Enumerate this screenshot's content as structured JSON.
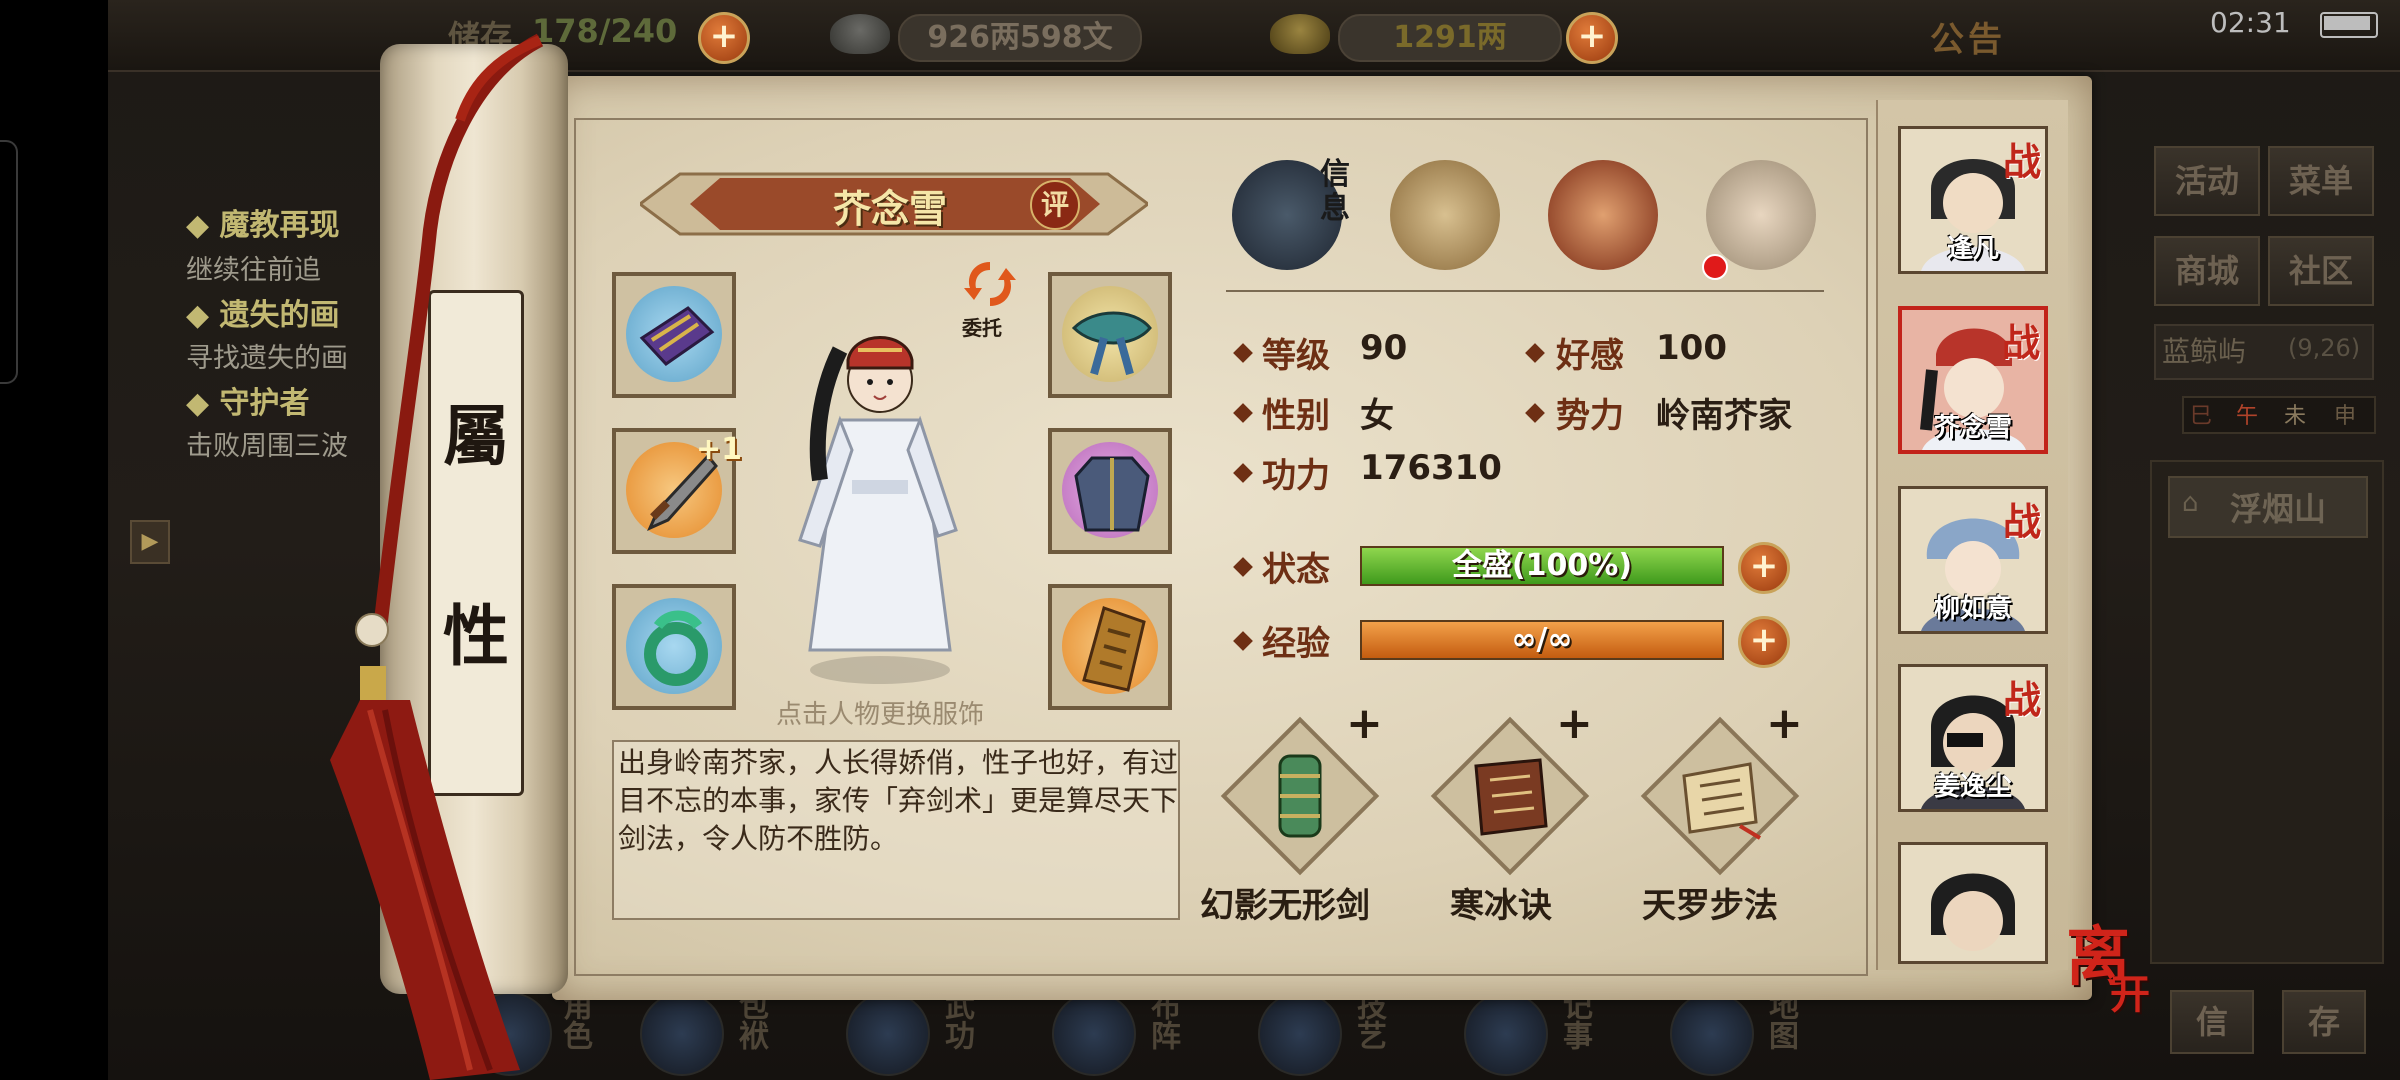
{
  "topbar": {
    "storage_label": "储存",
    "storage_value": "178/240",
    "money": "926两598文",
    "gold": "1291两",
    "announcement": "公告",
    "clock": "02:31"
  },
  "quests": [
    {
      "title": "魔教再现",
      "desc": "继续往前追"
    },
    {
      "title": "遗失的画",
      "desc": "寻找遗失的画"
    },
    {
      "title": "守护者",
      "desc": "击败周围三波"
    }
  ],
  "right_menu": {
    "activity": "活动",
    "menu": "菜单",
    "shop": "商城",
    "community": "社区",
    "location": "蓝鲸屿",
    "coords": "(9,26)",
    "time_marks": [
      "巳",
      "午",
      "未",
      "申"
    ],
    "destination": "浮烟山",
    "info_btn": "信",
    "save_btn": "存"
  },
  "scroll_tab": {
    "char1": "屬",
    "char2": "性"
  },
  "character": {
    "name": "芥念雪",
    "rate_label": "评",
    "delegate_label": "委托",
    "outfit_tip": "点击人物更换服饰",
    "bio": "出身岭南芥家，人长得娇俏，性子也好，有过目不忘的本事，家传「弃剑术」更是算尽天下剑法，令人防不胜防。",
    "equip_bonus": "+1"
  },
  "tabs": {
    "info_label": "信息"
  },
  "stats": {
    "level_label": "等级",
    "level": "90",
    "favor_label": "好感",
    "favor": "100",
    "gender_label": "性别",
    "gender": "女",
    "faction_label": "势力",
    "faction": "岭南芥家",
    "power_label": "功力",
    "power": "176310",
    "status_label": "状态",
    "status_value": "全盛(100%)",
    "status_fraction": 1.0,
    "exp_label": "经验",
    "exp_value": "∞/∞",
    "exp_fraction": 1.0
  },
  "skills": [
    {
      "name": "幻影无形剑"
    },
    {
      "name": "寒冰诀"
    },
    {
      "name": "天罗步法"
    }
  ],
  "party": [
    {
      "name": "逢凡",
      "battle": "战"
    },
    {
      "name": "芥念雪",
      "battle": "战"
    },
    {
      "name": "柳如意",
      "battle": "战"
    },
    {
      "name": "姜逸尘",
      "battle": "战"
    },
    {
      "name": "",
      "battle": ""
    }
  ],
  "leave": {
    "char1": "离",
    "char2": "开"
  },
  "bottom_nav": [
    "角色",
    "包袱",
    "武功",
    "布阵",
    "技艺",
    "记事",
    "地图"
  ],
  "colors": {
    "accent": "#6e2f14",
    "status_green": "#5fb82e",
    "exp_orange": "#e07a22",
    "battle_red": "#c0261a"
  }
}
